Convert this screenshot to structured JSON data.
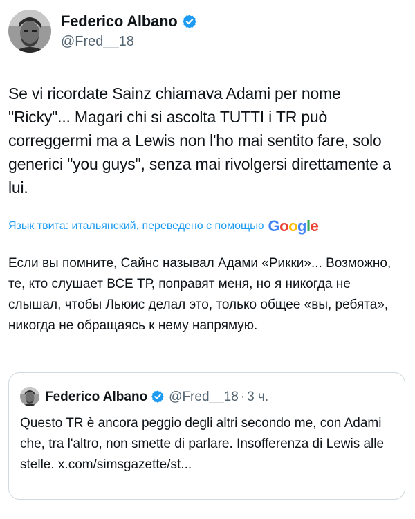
{
  "author": {
    "display_name": "Federico Albano",
    "handle": "@Fred__18",
    "verified_icon": "verified-badge-icon"
  },
  "tweet": {
    "text": "Se vi ricordate Sainz chiamava Adami per nome \"Ricky\"... Magari chi si ascolta TUTTI i TR può correggermi ma a Lewis non l'ho mai sentito fare, solo generici \"you guys\", senza mai rivolgersi direttamente a lui."
  },
  "translation": {
    "label": "Язык твита: итальянский, переведено с помощью",
    "provider_logo": "Google",
    "text": "Если вы помните, Сайнс называл Адами «Рикки»... Возможно, те, кто слушает ВСЕ ТР, поправят меня, но я никогда не слышал, чтобы Льюис делал это, только общее «вы, ребята», никогда не обращаясь к нему напрямую."
  },
  "quoted_tweet": {
    "display_name": "Federico Albano",
    "handle": "@Fred__18",
    "separator": "·",
    "time": "3 ч.",
    "text": "Questo TR è ancora peggio degli altri secondo me, con Adami che, tra l'altro, non smette di parlare. Insofferenza di Lewis alle stelle. x.com/simsgazette/st..."
  },
  "colors": {
    "accent": "#1d9bf0",
    "text_primary": "#0f1419",
    "text_secondary": "#536471",
    "border": "#cfd9de"
  }
}
